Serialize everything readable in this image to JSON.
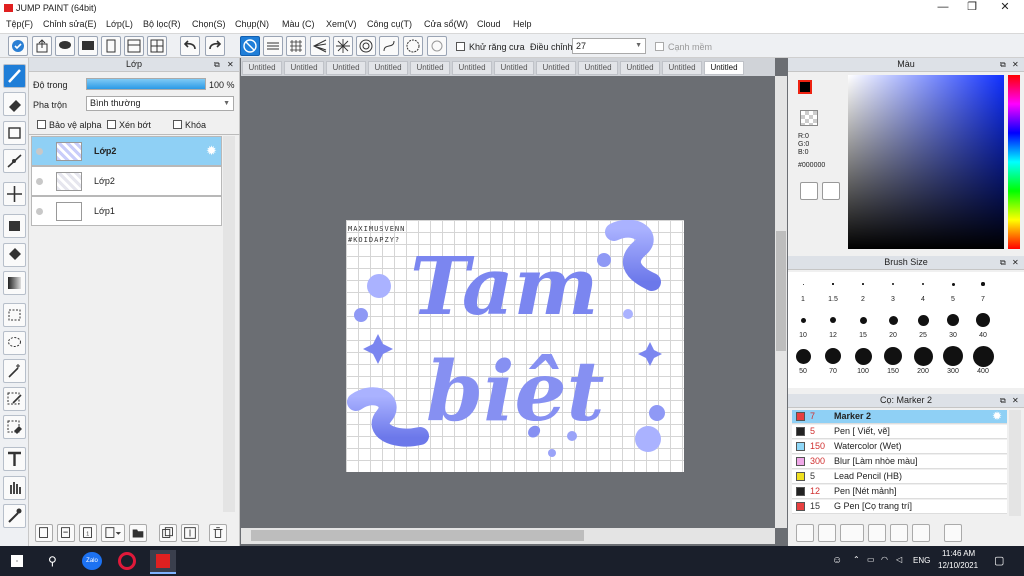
{
  "title": "JUMP PAINT (64bit)",
  "menu": [
    "Tệp(F)",
    "Chỉnh sửa(E)",
    "Lớp(L)",
    "Bộ lọc(R)",
    "Chọn(S)",
    "Chụp(N)",
    "Màu (C)",
    "Xem(V)",
    "Công cụ(T)",
    "Cửa sổ(W)",
    "Cloud",
    "Help"
  ],
  "toolbar": {
    "antialias_label": "Khử răng cưa",
    "adjust_label": "Điều chỉnh",
    "adjust_value": "27",
    "soften_label": "Cạnh mềm"
  },
  "layer_panel": {
    "title": "Lớp",
    "opacity_label": "Độ trong",
    "opacity_value": "100 %",
    "opacity_fraction": 1.0,
    "blend_label": "Pha trộn",
    "blend_value": "Bình thường",
    "protect_alpha": "Bảo vệ alpha",
    "clip": "Xén bớt",
    "lock": "Khóa",
    "layers": [
      {
        "name": "Lớp2",
        "selected": true
      },
      {
        "name": "Lớp2",
        "selected": false
      },
      {
        "name": "Lớp1",
        "selected": false
      }
    ]
  },
  "tabs": [
    "Untitled",
    "Untitled",
    "Untitled",
    "Untitled",
    "Untitled",
    "Untitled",
    "Untitled",
    "Untitled",
    "Untitled",
    "Untitled",
    "Untitled",
    "Untitled"
  ],
  "artwork": {
    "watermark_line1": "MAXIMUSVENN",
    "watermark_line2": "#KOIDAPZY?",
    "word1": "Tam",
    "word2": "biệt",
    "accent": "#7b86f0"
  },
  "color_panel": {
    "title": "Màu",
    "r": "R:0",
    "g": "G:0",
    "b": "B:0",
    "hex": "#000000"
  },
  "brush_size": {
    "title": "Brush Size",
    "sizes": [
      "1",
      "1.5",
      "2",
      "3",
      "4",
      "5",
      "7",
      "10",
      "12",
      "15",
      "20",
      "25",
      "30",
      "40",
      "50",
      "70",
      "100",
      "150",
      "200",
      "300",
      "400"
    ]
  },
  "brush_list": {
    "title": "Cọ: Marker 2",
    "items": [
      {
        "size": "7",
        "name": "Marker 2",
        "color": "#e84040",
        "selected": true
      },
      {
        "size": "5",
        "name": "Pen [ Viết, vẽ]",
        "color": "#222222",
        "selected": false
      },
      {
        "size": "150",
        "name": "Watercolor (Wet)",
        "color": "#8fd8f8",
        "selected": false
      },
      {
        "size": "300",
        "name": "Blur [Làm nhòe màu]",
        "color": "#f0a8e8",
        "selected": false
      },
      {
        "size": "5",
        "name": "Lead Pencil (HB)",
        "color": "#f0e020",
        "selected": false
      },
      {
        "size": "12",
        "name": "Pen [Nét mảnh]",
        "color": "#222222",
        "selected": false
      },
      {
        "size": "15",
        "name": "G Pen [Cọ trang trí]",
        "color": "#e84040",
        "selected": false
      }
    ]
  },
  "taskbar": {
    "lang": "ENG",
    "time": "11:46 AM",
    "date": "12/10/2021",
    "zalo": "Zalo"
  }
}
